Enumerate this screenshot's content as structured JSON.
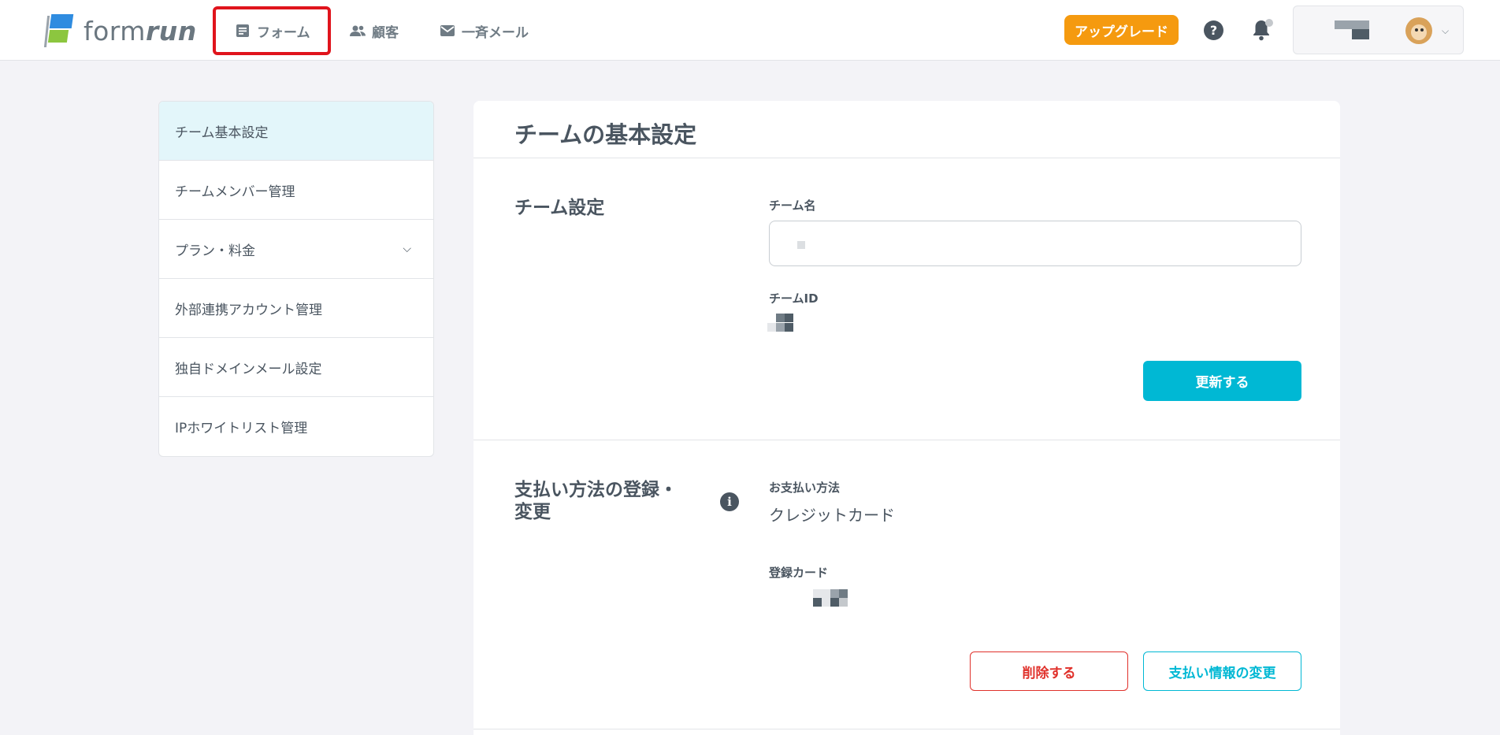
{
  "header": {
    "logo_text_light": "form",
    "logo_text_bold": "run",
    "nav": [
      {
        "label": "フォーム",
        "icon": "form-icon"
      },
      {
        "label": "顧客",
        "icon": "customers-icon"
      },
      {
        "label": "一斉メール",
        "icon": "mail-icon"
      }
    ],
    "upgrade_label": "アップグレード",
    "help_symbol": "?"
  },
  "sidebar": {
    "items": [
      {
        "label": "チーム基本設定",
        "active": true
      },
      {
        "label": "チームメンバー管理"
      },
      {
        "label": "プラン・料金",
        "has_chevron": true
      },
      {
        "label": "外部連携アカウント管理"
      },
      {
        "label": "独自ドメインメール設定"
      },
      {
        "label": "IPホワイトリスト管理"
      }
    ]
  },
  "main": {
    "title": "チームの基本設定",
    "team_section": {
      "title": "チーム設定",
      "name_label": "チーム名",
      "id_label": "チームID",
      "update_button": "更新する"
    },
    "payment_section": {
      "title_line1": "支払い方法の登録・",
      "title_line2": "変更",
      "method_label": "お支払い方法",
      "method_value": "クレジットカード",
      "card_label": "登録カード",
      "delete_button": "削除する",
      "change_button": "支払い情報の変更"
    }
  },
  "colors": {
    "accent": "#00b8d4",
    "upgrade": "#f59a0f",
    "danger": "#e0312b",
    "highlight": "#e0141c"
  }
}
